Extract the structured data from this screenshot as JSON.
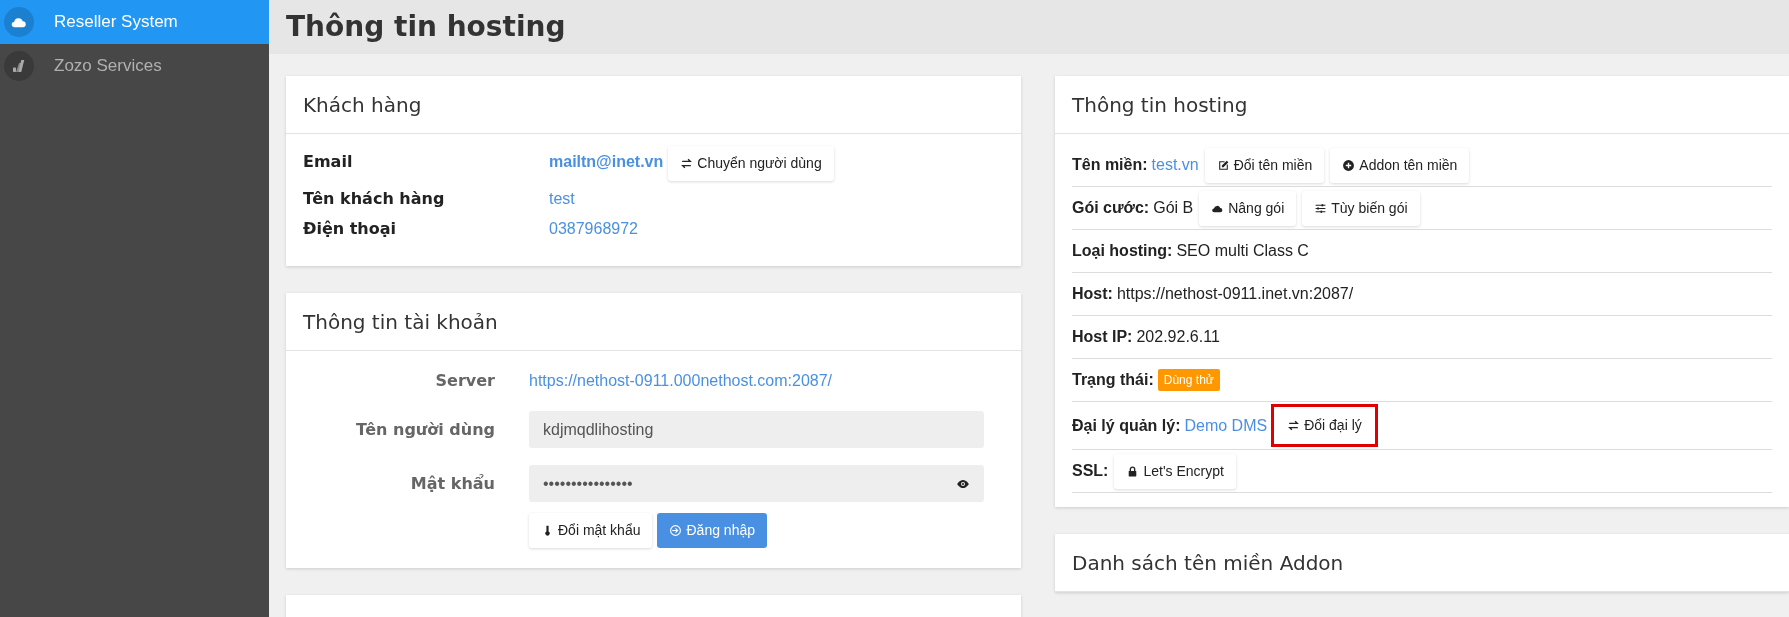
{
  "sidebar": {
    "items": [
      {
        "label": "Reseller System",
        "selected": true
      },
      {
        "label": "Zozo Services",
        "selected": false
      }
    ]
  },
  "page_title": "Thông tin hosting",
  "customer_card": {
    "title": "Khách hàng",
    "rows": [
      {
        "label": "Email",
        "value": "mailtn@inet.vn",
        "bold": true,
        "button": "Chuyển người dùng"
      },
      {
        "label": "Tên khách hàng",
        "value": "test",
        "bold": false
      },
      {
        "label": "Điện thoại",
        "value": "0387968972",
        "bold": false
      }
    ]
  },
  "account_card": {
    "title": "Thông tin tài khoản",
    "server_label": "Server",
    "server_url": "https://nethost-0911.000nethost.com:2087/",
    "username_label": "Tên người dùng",
    "username": "kdjmqdlihosting",
    "password_label": "Mật khẩu",
    "password": "••••••••••••••••",
    "buttons": [
      {
        "label": "Đổi mật khẩu",
        "kind": "default"
      },
      {
        "label": "Đăng nhập",
        "kind": "primary"
      }
    ]
  },
  "hosting_card": {
    "title": "Thông tin hosting",
    "rows": [
      {
        "label": "Tên miền:",
        "value": "test.vn",
        "kind": "link",
        "buttons": [
          {
            "label": "Đổi tên miền",
            "highlighted": false
          },
          {
            "label": "Addon tên miền",
            "highlighted": false
          }
        ]
      },
      {
        "label": "Gói cước:",
        "value": "Gói B",
        "kind": "text",
        "buttons": [
          {
            "label": "Nâng gói",
            "highlighted": false
          },
          {
            "label": "Tùy biến gói",
            "highlighted": false
          }
        ]
      },
      {
        "label": "Loại hosting:",
        "value": "SEO multi Class C",
        "kind": "text"
      },
      {
        "label": "Host:",
        "value": "https://nethost-0911.inet.vn:2087/",
        "kind": "text"
      },
      {
        "label": "Host IP:",
        "value": "202.92.6.11",
        "kind": "text"
      },
      {
        "label": "Trạng thái:",
        "value": "Dùng thử",
        "kind": "badge",
        "color": "#ff9800"
      },
      {
        "label": "Đại lý quản lý:",
        "value": "Demo DMS",
        "kind": "link",
        "buttons": [
          {
            "label": "Đổi đại lý",
            "highlighted": true
          }
        ]
      },
      {
        "label": "SSL:",
        "kind": "buttons",
        "buttons": [
          {
            "label": "Let's Encrypt",
            "highlighted": false
          }
        ]
      }
    ]
  },
  "addon_card": {
    "title": "Danh sách tên miền Addon"
  }
}
